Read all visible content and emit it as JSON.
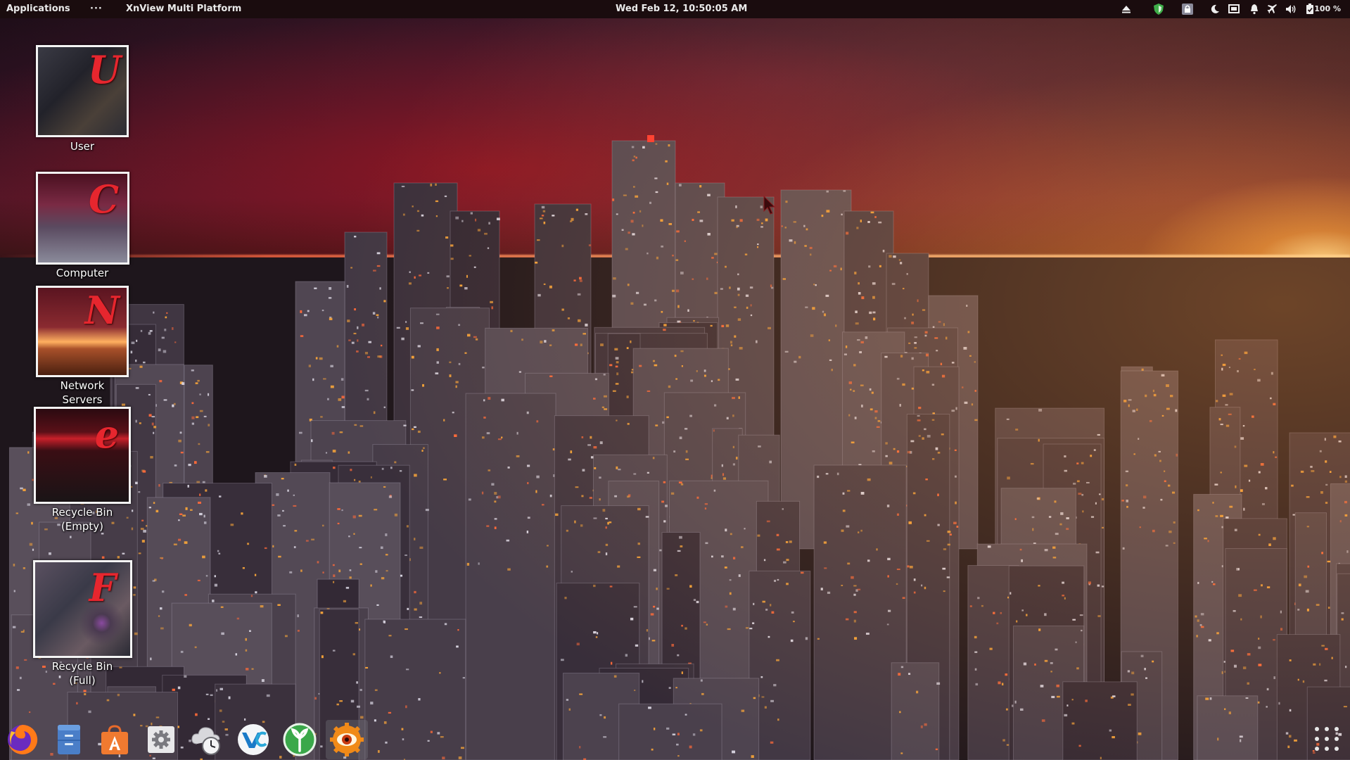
{
  "top_panel": {
    "applications_label": "Applications",
    "overflow_label": "···",
    "active_app": "XnView Multi Platform",
    "clock": "Wed Feb 12, 10:50:05 AM",
    "battery_percent": "100 %",
    "tray_icons": [
      "eject-icon",
      "shield-icon",
      "lock-icon",
      "night-mode-icon",
      "screen-icon",
      "notification-icon",
      "airplane-icon",
      "volume-icon",
      "battery-icon"
    ]
  },
  "desktop_icons": [
    {
      "label": "User",
      "letter": "U"
    },
    {
      "label": "Computer",
      "letter": "C"
    },
    {
      "label": "Network Servers",
      "label_line1": "Network",
      "label_line2": "Servers",
      "letter": "N"
    },
    {
      "label": "Recycle Bin (Empty)",
      "label_line1": "Recycle Bin",
      "label_line2": "(Empty)",
      "letter": "e"
    },
    {
      "label": "Recycle Bin (Full)",
      "label_line1": "Recycle Bin",
      "label_line2": "(Full)",
      "letter": "F"
    }
  ],
  "dock": {
    "items": [
      "firefox-icon",
      "files-icon",
      "software-center-icon",
      "settings-icon",
      "backup-icon",
      "veracrypt-icon",
      "bleachbit-icon",
      "xnview-icon"
    ],
    "veracrypt_text": "VC"
  },
  "colors": {
    "panel_bg": "#1a0c0e",
    "icon_letter_red": "#e6262e"
  }
}
